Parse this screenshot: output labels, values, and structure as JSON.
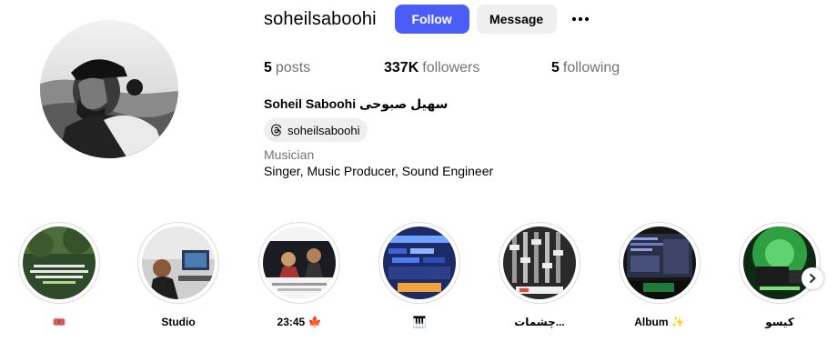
{
  "profile": {
    "username": "soheilsaboohi",
    "follow_label": "Follow",
    "message_label": "Message",
    "full_name": "Soheil Saboohi سهیل صبوحی",
    "threads_handle": "soheilsaboohi",
    "category": "Musician",
    "bio": "Singer, Music Producer, Sound Engineer",
    "colors": {
      "accent": "#4a5df9",
      "secondary_button": "#efefef",
      "muted_text": "#737373"
    }
  },
  "stats": [
    {
      "count": "5",
      "label": "posts"
    },
    {
      "count": "337K",
      "label": "followers"
    },
    {
      "count": "5",
      "label": "following"
    }
  ],
  "highlights": [
    {
      "label": "🎟️",
      "theme": "forest"
    },
    {
      "label": "Studio",
      "theme": "studio"
    },
    {
      "label": "23:45 🍁",
      "theme": "stage"
    },
    {
      "label": "🎹",
      "theme": "daw"
    },
    {
      "label": "چشمات...",
      "theme": "mixer"
    },
    {
      "label": "Album ✨",
      "theme": "monitor"
    },
    {
      "label": "کیسو",
      "theme": "green"
    }
  ],
  "icons": {
    "more": "more-dots-icon",
    "threads": "threads-icon",
    "next": "chevron-right-icon"
  }
}
